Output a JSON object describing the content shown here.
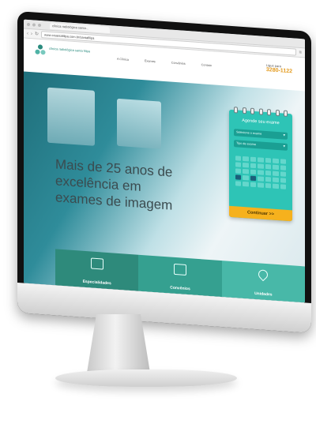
{
  "browser": {
    "tab_title": "clínica radiológica santa...",
    "url": "www.crsantafilipa.com.br/santafilipa"
  },
  "site": {
    "logo_text": "clínica radiológica santa filipa",
    "nav": [
      "A Clínica",
      "Exames",
      "Convênios",
      "Contato"
    ],
    "phone_label": "Ligue para",
    "phone_number": "3280-1122"
  },
  "hero": {
    "title": "Mais de 25 anos de excelência em exames de imagem"
  },
  "schedule": {
    "title": "Agende seu exame",
    "select_1": "Selecione o exame",
    "select_2": "Tipo de exame",
    "cta": "Continuar >>"
  },
  "features": [
    {
      "label": "Especialidades"
    },
    {
      "label": "Convênios"
    },
    {
      "label": "Unidades"
    }
  ],
  "colors": {
    "accent": "#2ec4b6",
    "cta": "#f6b11d",
    "phone": "#e39a1c"
  }
}
